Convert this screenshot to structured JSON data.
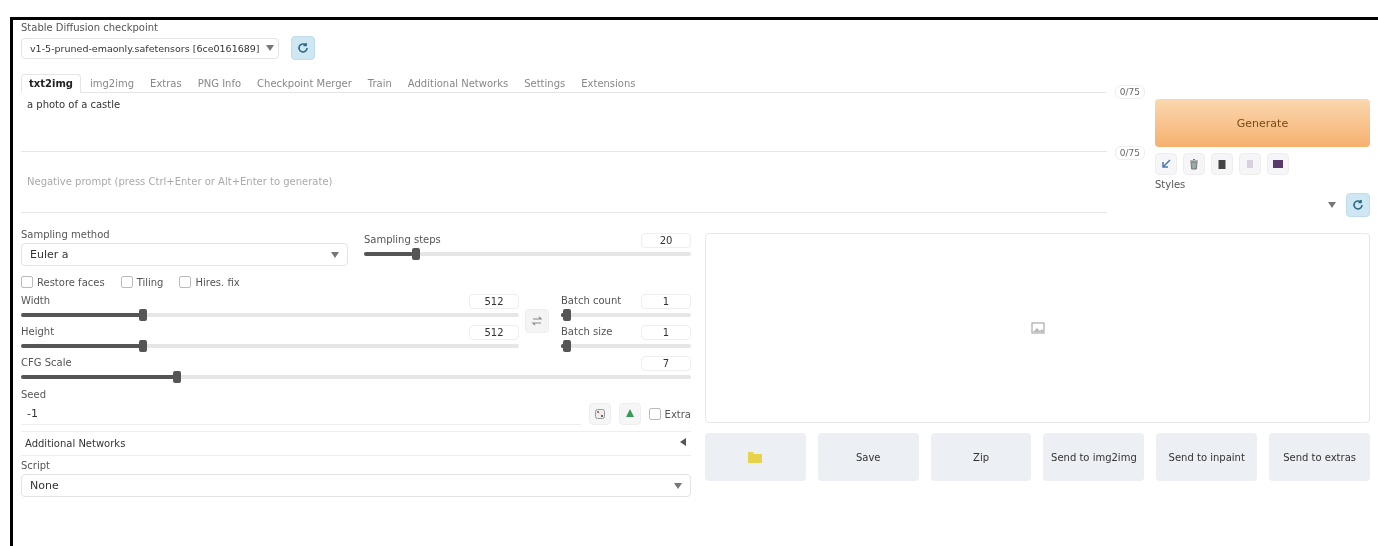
{
  "model": {
    "label": "Stable Diffusion checkpoint",
    "value": "v1-5-pruned-emaonly.safetensors [6ce0161689]"
  },
  "tabs": [
    {
      "label": "txt2img",
      "selected": true
    },
    {
      "label": "img2img",
      "selected": false
    },
    {
      "label": "Extras",
      "selected": false
    },
    {
      "label": "PNG Info",
      "selected": false
    },
    {
      "label": "Checkpoint Merger",
      "selected": false
    },
    {
      "label": "Train",
      "selected": false
    },
    {
      "label": "Additional Networks",
      "selected": false
    },
    {
      "label": "Settings",
      "selected": false
    },
    {
      "label": "Extensions",
      "selected": false
    }
  ],
  "prompt": {
    "value": "a photo of a castle",
    "counter": "0/75"
  },
  "negative_prompt": {
    "placeholder": "Negative prompt (press Ctrl+Enter or Alt+Enter to generate)",
    "counter": "0/75"
  },
  "generate": "Generate",
  "styles": {
    "label": "Styles"
  },
  "sampling_method": {
    "label": "Sampling method",
    "value": "Euler a"
  },
  "sampling_steps": {
    "label": "Sampling steps",
    "value": "20",
    "level": 0.15
  },
  "checkboxes": [
    {
      "label": "Restore faces",
      "checked": false
    },
    {
      "label": "Tiling",
      "checked": false
    },
    {
      "label": "Hires. fix",
      "checked": false
    }
  ],
  "width": {
    "label": "Width",
    "value": "512",
    "level": 0.24
  },
  "height": {
    "label": "Height",
    "value": "512",
    "level": 0.24
  },
  "batch_count": {
    "label": "Batch count",
    "value": "1",
    "level": 0.02
  },
  "batch_size": {
    "label": "Batch size",
    "value": "1",
    "level": 0.02
  },
  "cfg_scale": {
    "label": "CFG Scale",
    "value": "7",
    "level": 0.23
  },
  "seed": {
    "label": "Seed",
    "value": "-1",
    "extra": {
      "label": "Extra",
      "checked": false
    }
  },
  "additional_networks": {
    "label": "Additional Networks",
    "expanded": false
  },
  "script": {
    "label": "Script",
    "value": "None"
  },
  "output_buttons": [
    {
      "kind": "folder"
    },
    {
      "kind": "text",
      "label": "Save"
    },
    {
      "kind": "text",
      "label": "Zip"
    },
    {
      "kind": "text",
      "label": "Send to img2img"
    },
    {
      "kind": "text",
      "label": "Send to inpaint"
    },
    {
      "kind": "text",
      "label": "Send to extras"
    }
  ]
}
